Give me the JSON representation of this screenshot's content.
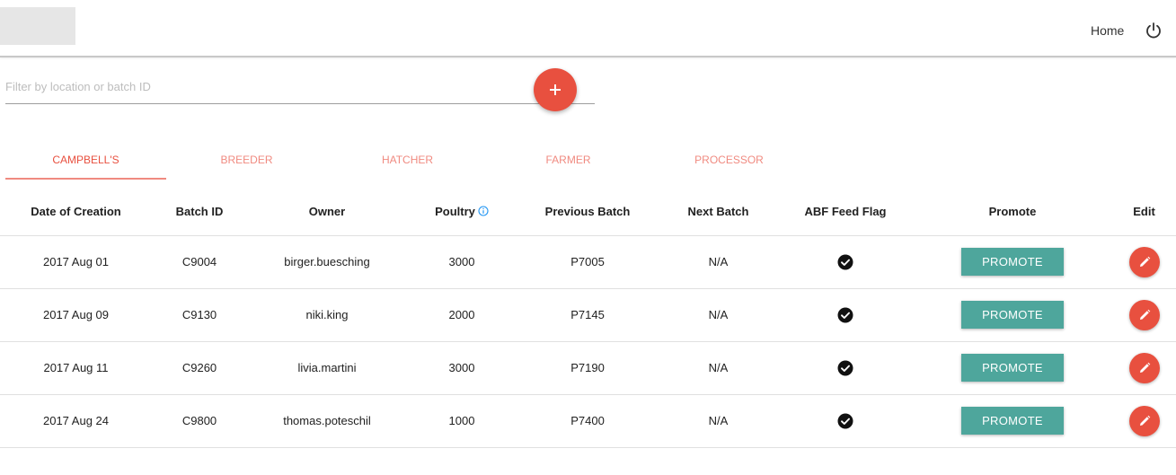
{
  "header": {
    "nav_home": "Home",
    "icons": {
      "logo": "logo-placeholder",
      "power": "power-icon"
    }
  },
  "filter": {
    "placeholder": "Filter by location or batch ID",
    "value": ""
  },
  "fab": {
    "label": "+",
    "icon": "add-icon"
  },
  "tabs": [
    {
      "label": "CAMPBELL'S",
      "active": true
    },
    {
      "label": "BREEDER",
      "active": false
    },
    {
      "label": "HATCHER",
      "active": false
    },
    {
      "label": "FARMER",
      "active": false
    },
    {
      "label": "PROCESSOR",
      "active": false
    }
  ],
  "table": {
    "columns": [
      "Date of Creation",
      "Batch ID",
      "Owner",
      "Poultry",
      "Previous Batch",
      "Next Batch",
      "ABF Feed Flag",
      "Promote",
      "Edit"
    ],
    "rows": [
      {
        "date": "2017 Aug 01",
        "batch_id": "C9004",
        "owner": "birger.buesching",
        "poultry": "3000",
        "previous": "P7005",
        "next": "N/A",
        "abf": true,
        "promote": "PROMOTE"
      },
      {
        "date": "2017 Aug 09",
        "batch_id": "C9130",
        "owner": "niki.king",
        "poultry": "2000",
        "previous": "P7145",
        "next": "N/A",
        "abf": true,
        "promote": "PROMOTE"
      },
      {
        "date": "2017 Aug 11",
        "batch_id": "C9260",
        "owner": "livia.martini",
        "poultry": "3000",
        "previous": "P7190",
        "next": "N/A",
        "abf": true,
        "promote": "PROMOTE"
      },
      {
        "date": "2017 Aug 24",
        "batch_id": "C9800",
        "owner": "thomas.poteschil",
        "poultry": "1000",
        "previous": "P7400",
        "next": "N/A",
        "abf": true,
        "promote": "PROMOTE"
      }
    ]
  },
  "colors": {
    "accent": "#e8503f",
    "accent_light": "#f08a80",
    "promote": "#4ea69c",
    "info": "#2196f3"
  }
}
